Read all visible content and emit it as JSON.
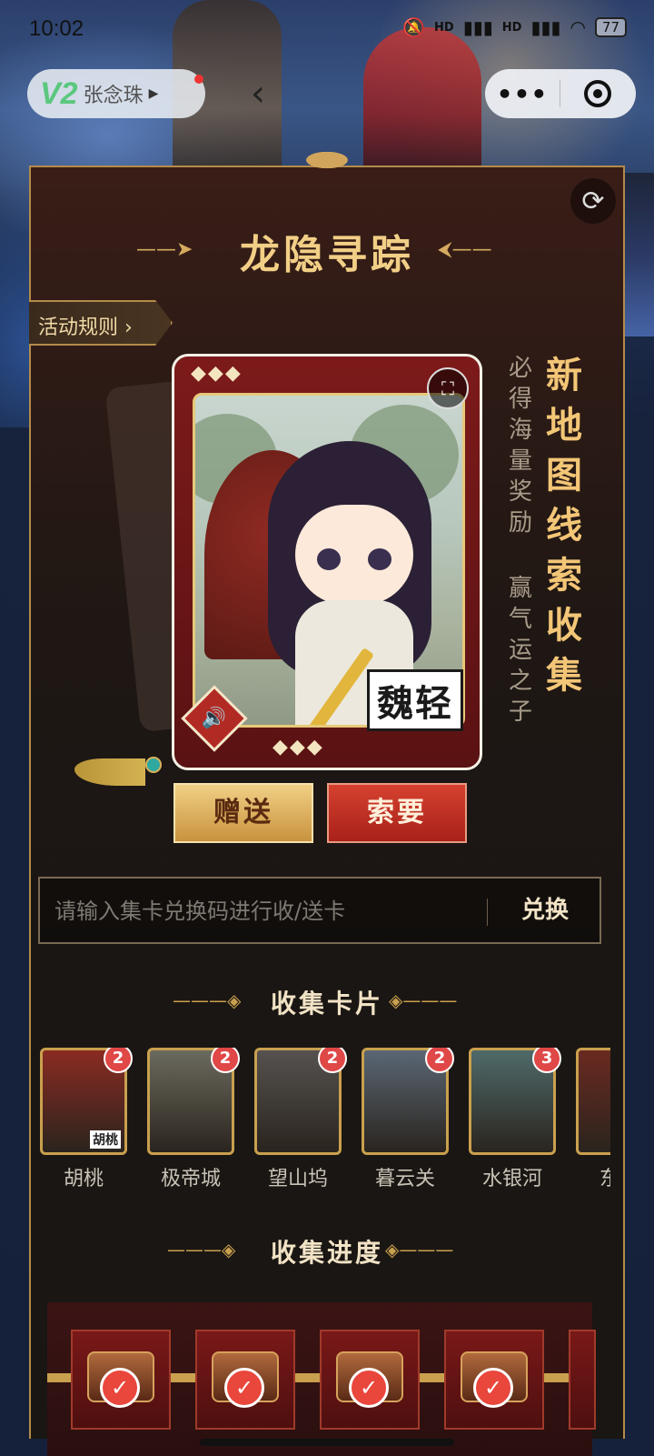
{
  "status_bar": {
    "time": "10:02",
    "battery": "77",
    "signal_1": "HD",
    "signal_2": "HD"
  },
  "header": {
    "app_badge": "V2",
    "user_name": "张念珠"
  },
  "event": {
    "title": "龙隐寻踪",
    "rules_label": "活动规则",
    "rules_chevron": "›",
    "slogan_main": [
      "新",
      "地",
      "图",
      "线",
      "索",
      "收",
      "集"
    ],
    "slogan_sub_1": [
      "必",
      "得",
      "海",
      "量",
      "奖",
      "励"
    ],
    "slogan_sub_2": [
      "赢",
      "气",
      "运",
      "之",
      "子"
    ]
  },
  "card": {
    "name": "魏轻",
    "diamonds": "◆◆◆"
  },
  "actions": {
    "gift_label": "赠送",
    "request_label": "索要"
  },
  "redeem": {
    "placeholder": "请输入集卡兑换码进行收/送卡",
    "button_label": "兑换"
  },
  "collect_section": {
    "title": "收集卡片",
    "cards": [
      {
        "name": "胡桃",
        "count": "2",
        "tag": "胡桃",
        "color": "#8a2b22"
      },
      {
        "name": "极帝城",
        "count": "2",
        "color": "#6b6a5e"
      },
      {
        "name": "望山坞",
        "count": "2",
        "color": "#55524f"
      },
      {
        "name": "暮云关",
        "count": "2",
        "color": "#5a6774"
      },
      {
        "name": "水银河",
        "count": "3",
        "color": "#4f6a6a"
      },
      {
        "name": "东君",
        "count": "",
        "color": "#6a2a20"
      }
    ]
  },
  "progress_section": {
    "title": "收集进度",
    "check_icon": "✓"
  },
  "icons": {
    "refresh": "refresh-icon",
    "back": "back-arrow-icon",
    "more": "more-dots-icon",
    "target": "target-icon",
    "expand": "expand-icon",
    "sound": "speaker-icon"
  },
  "colors": {
    "gold": "#f2cf86",
    "accent_red": "#e04747",
    "panel_border": "#b38b4a"
  }
}
